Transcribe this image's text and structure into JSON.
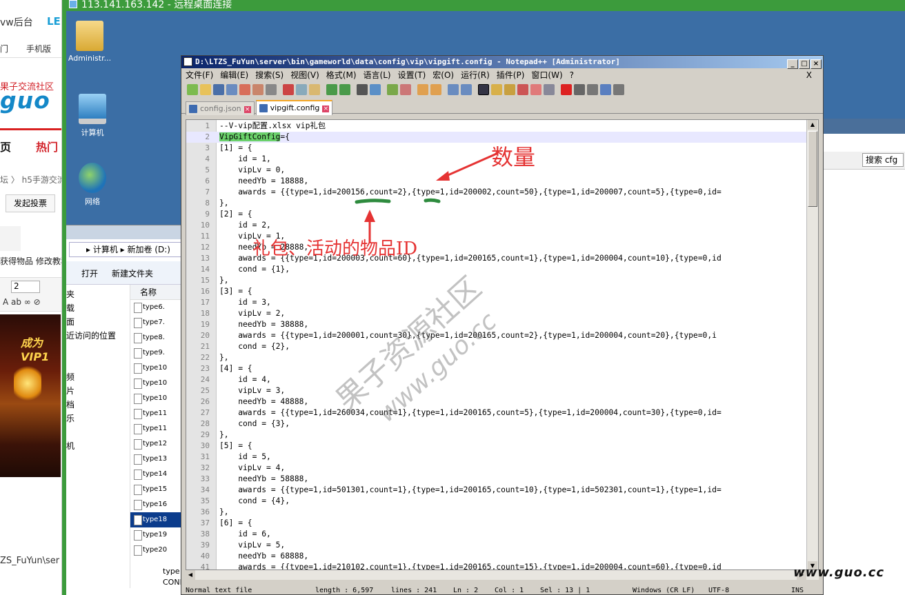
{
  "browser": {
    "title": "vw后台",
    "title2": "LE",
    "bar_left": "门",
    "bar_right": "手机版",
    "logo_red": "果子交流社区",
    "logo": "guo",
    "nav1": "页",
    "nav2": "热门",
    "crumb": "坛 〉 h5手游交流",
    "post_button": "发起投票",
    "post_text": "获得物品 修改教程",
    "editor_size": "2",
    "game_banner": "成为VIP1",
    "path": "ZS_FuYun\\ser"
  },
  "rdp": {
    "title": "113.141.163.142 - 远程桌面连接"
  },
  "desktop": {
    "icons": [
      {
        "label": "Administr..."
      },
      {
        "label": "计算机"
      },
      {
        "label": "网络"
      }
    ]
  },
  "explorer": {
    "address": "▸ 计算机 ▸ 新加卷 (D:)",
    "open": "打开",
    "new_folder": "新建文件夹",
    "column_name": "名称",
    "nav_items": [
      "夹",
      "载",
      "面",
      "近访问的位置",
      "",
      "",
      "频",
      "片",
      "档",
      "乐",
      "",
      "机"
    ],
    "files": [
      "type6.",
      "type7.",
      "type8.",
      "type9.",
      "type10",
      "type10",
      "type10",
      "type11",
      "type11",
      "type12",
      "type13",
      "type14",
      "type15",
      "type16",
      "type18",
      "type19",
      "type20"
    ],
    "bottom_type": "type",
    "bottom_conf": "CONF"
  },
  "right_window": {
    "search": "搜索 cfg"
  },
  "notepad": {
    "title": "D:\\LTZS_FuYun\\server\\bin\\gameworld\\data\\config\\vip\\vipgift.config - Notepad++ [Administrator]",
    "menu": [
      "文件(F)",
      "编辑(E)",
      "搜索(S)",
      "视图(V)",
      "格式(M)",
      "语言(L)",
      "设置(T)",
      "宏(O)",
      "运行(R)",
      "插件(P)",
      "窗口(W)",
      "?"
    ],
    "menu_close": "X",
    "tabs": [
      {
        "label": "config.json",
        "active": false
      },
      {
        "label": "vipgift.config",
        "active": true
      }
    ],
    "lines": [
      "--V-vip配置.xlsx vip礼包",
      "VipGiftConfig={",
      "[1] = {",
      "    id = 1,",
      "    vipLv = 0,",
      "    needYb = 18888,",
      "    awards = {{type=1,id=200156,count=2},{type=1,id=200002,count=50},{type=1,id=200007,count=5},{type=0,id=",
      "},",
      "[2] = {",
      "    id = 2,",
      "    vipLv = 1,",
      "    needYb = 28888,",
      "    awards = {{type=1,id=200003,count=60},{type=1,id=200165,count=1},{type=1,id=200004,count=10},{type=0,id",
      "    cond = {1},",
      "},",
      "[3] = {",
      "    id = 3,",
      "    vipLv = 2,",
      "    needYb = 38888,",
      "    awards = {{type=1,id=200001,count=30},{type=1,id=200165,count=2},{type=1,id=200004,count=20},{type=0,i",
      "    cond = {2},",
      "},",
      "[4] = {",
      "    id = 4,",
      "    vipLv = 3,",
      "    needYb = 48888,",
      "    awards = {{type=1,id=260034,count=1},{type=1,id=200165,count=5},{type=1,id=200004,count=30},{type=0,id=",
      "    cond = {3},",
      "},",
      "[5] = {",
      "    id = 5,",
      "    vipLv = 4,",
      "    needYb = 58888,",
      "    awards = {{type=1,id=501301,count=1},{type=1,id=200165,count=10},{type=1,id=502301,count=1},{type=1,id=",
      "    cond = {4},",
      "},",
      "[6] = {",
      "    id = 6,",
      "    vipLv = 5,",
      "    needYb = 68888,",
      "    awards = {{type=1,id=210102,count=1},{type=1,id=200165,count=15},{type=1,id=200004,count=60},{type=0,id"
    ],
    "status": {
      "file_type": "Normal text file",
      "length": "length : 6,597",
      "lines": "lines : 241",
      "ln": "Ln : 2",
      "col": "Col : 1",
      "sel": "Sel : 13 | 1",
      "eol": "Windows (CR LF)",
      "encoding": "UTF-8",
      "mode": "INS"
    }
  },
  "annotations": {
    "quantity": "数量",
    "gift_id": "礼包、活动的物品ID",
    "watermark": "果子资源社区",
    "watermark_url": "www.guo.cc",
    "corner": "www.guo.cc"
  },
  "colors": {
    "annotation_red": "#e53333",
    "underline_green": "#2e8b3e",
    "rdp_green": "#3c9b3c",
    "desktop_blue": "#3b6ea5"
  }
}
